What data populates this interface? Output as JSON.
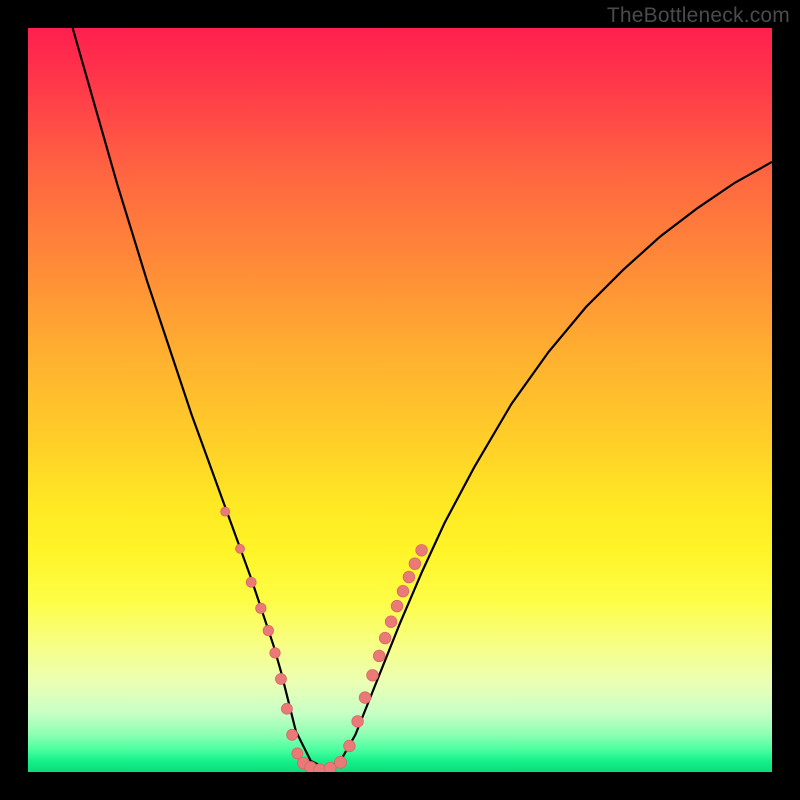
{
  "watermark": "TheBottleneck.com",
  "chart_data": {
    "type": "line",
    "title": "",
    "xlabel": "",
    "ylabel": "",
    "xlim": [
      0,
      100
    ],
    "ylim": [
      0,
      100
    ],
    "series": [
      {
        "name": "bottleneck-curve",
        "x": [
          6,
          8,
          10,
          12,
          14,
          16,
          18,
          20,
          22,
          24,
          26,
          28,
          30,
          31,
          32,
          33,
          34,
          35,
          36,
          38,
          40,
          42,
          44,
          46,
          48,
          50,
          53,
          56,
          60,
          65,
          70,
          75,
          80,
          85,
          90,
          95,
          100
        ],
        "y": [
          100,
          93,
          86,
          79,
          72.5,
          66,
          60,
          54,
          48,
          42.5,
          37,
          31.5,
          26,
          23,
          20,
          17,
          13.5,
          9.5,
          5.5,
          1.5,
          0.5,
          1.5,
          5,
          10,
          15,
          20,
          27,
          33.5,
          41,
          49.5,
          56.5,
          62.5,
          67.5,
          72,
          75.8,
          79.2,
          82
        ]
      }
    ],
    "markers": {
      "name": "sample-points",
      "x": [
        26.5,
        28.5,
        30.0,
        31.3,
        32.3,
        33.2,
        34.0,
        34.8,
        35.5,
        36.2,
        37.0,
        38.0,
        39.2,
        40.6,
        42.0,
        43.2,
        44.3,
        45.3,
        46.3,
        47.2,
        48.0,
        48.8,
        49.6,
        50.4,
        51.2,
        52.0,
        52.9
      ],
      "y": [
        35.0,
        30.0,
        25.5,
        22.0,
        19.0,
        16.0,
        12.5,
        8.5,
        5.0,
        2.5,
        1.2,
        0.6,
        0.3,
        0.5,
        1.3,
        3.5,
        6.8,
        10.0,
        13.0,
        15.6,
        18.0,
        20.2,
        22.3,
        24.3,
        26.2,
        28.0,
        29.8
      ],
      "r": [
        4.5,
        4.5,
        5.0,
        5.2,
        5.2,
        5.2,
        5.5,
        5.5,
        5.5,
        5.5,
        5.8,
        6.0,
        6.0,
        6.0,
        6.0,
        5.8,
        5.8,
        5.8,
        5.8,
        5.8,
        5.8,
        5.8,
        5.8,
        5.8,
        5.8,
        5.8,
        5.8
      ]
    },
    "gradient_stops": [
      {
        "pos": 0,
        "color": "#ff1f4e"
      },
      {
        "pos": 0.5,
        "color": "#ffd028"
      },
      {
        "pos": 0.85,
        "color": "#f7ff86"
      },
      {
        "pos": 1.0,
        "color": "#0bdc7f"
      }
    ]
  }
}
